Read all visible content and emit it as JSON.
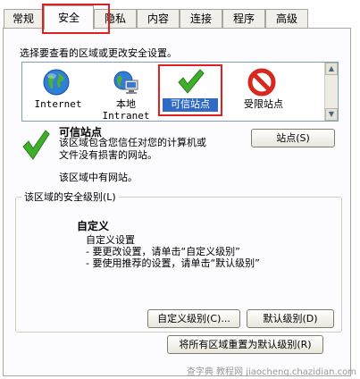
{
  "tabs": [
    {
      "label": "常规"
    },
    {
      "label": "安全"
    },
    {
      "label": "隐私"
    },
    {
      "label": "内容"
    },
    {
      "label": "连接"
    },
    {
      "label": "程序"
    },
    {
      "label": "高级"
    }
  ],
  "instruction": "选择要查看的区域或更改安全设置。",
  "zones": [
    {
      "label": "Internet",
      "icon": "globe-icon"
    },
    {
      "label": "本地\nIntranet",
      "icon": "intranet-icon"
    },
    {
      "label": "可信站点",
      "icon": "checkmark-icon",
      "selected": true
    },
    {
      "label": "受限站点",
      "icon": "no-entry-icon"
    }
  ],
  "zone_info": {
    "title": "可信站点",
    "description": "该区域包含您信任对您的计算机或\n文件没有损害的网站。",
    "no_sites": "该区域中有网站。",
    "sites_button": "站点(S)"
  },
  "security_level": {
    "group_title": "该区域的安全级别(L)",
    "level_name": "自定义",
    "level_desc_line1": "自定义设置",
    "level_desc_line2": "- 要更改设置，请单击“自定义级别”",
    "level_desc_line3": "- 要使用推荐的设置，请单击“默认级别”",
    "custom_level_button": "自定义级别(C)...",
    "default_level_button": "默认级别(D)"
  },
  "reset_all_button": "将所有区域重置为默认级别(R)",
  "watermark": "查字典 教程网 jiaocheng.chazidian.com",
  "colors": {
    "highlight_border": "#e02020",
    "selection": "#316ac5",
    "check_green": "#3fae2a",
    "no_entry_red": "#d8281e"
  }
}
